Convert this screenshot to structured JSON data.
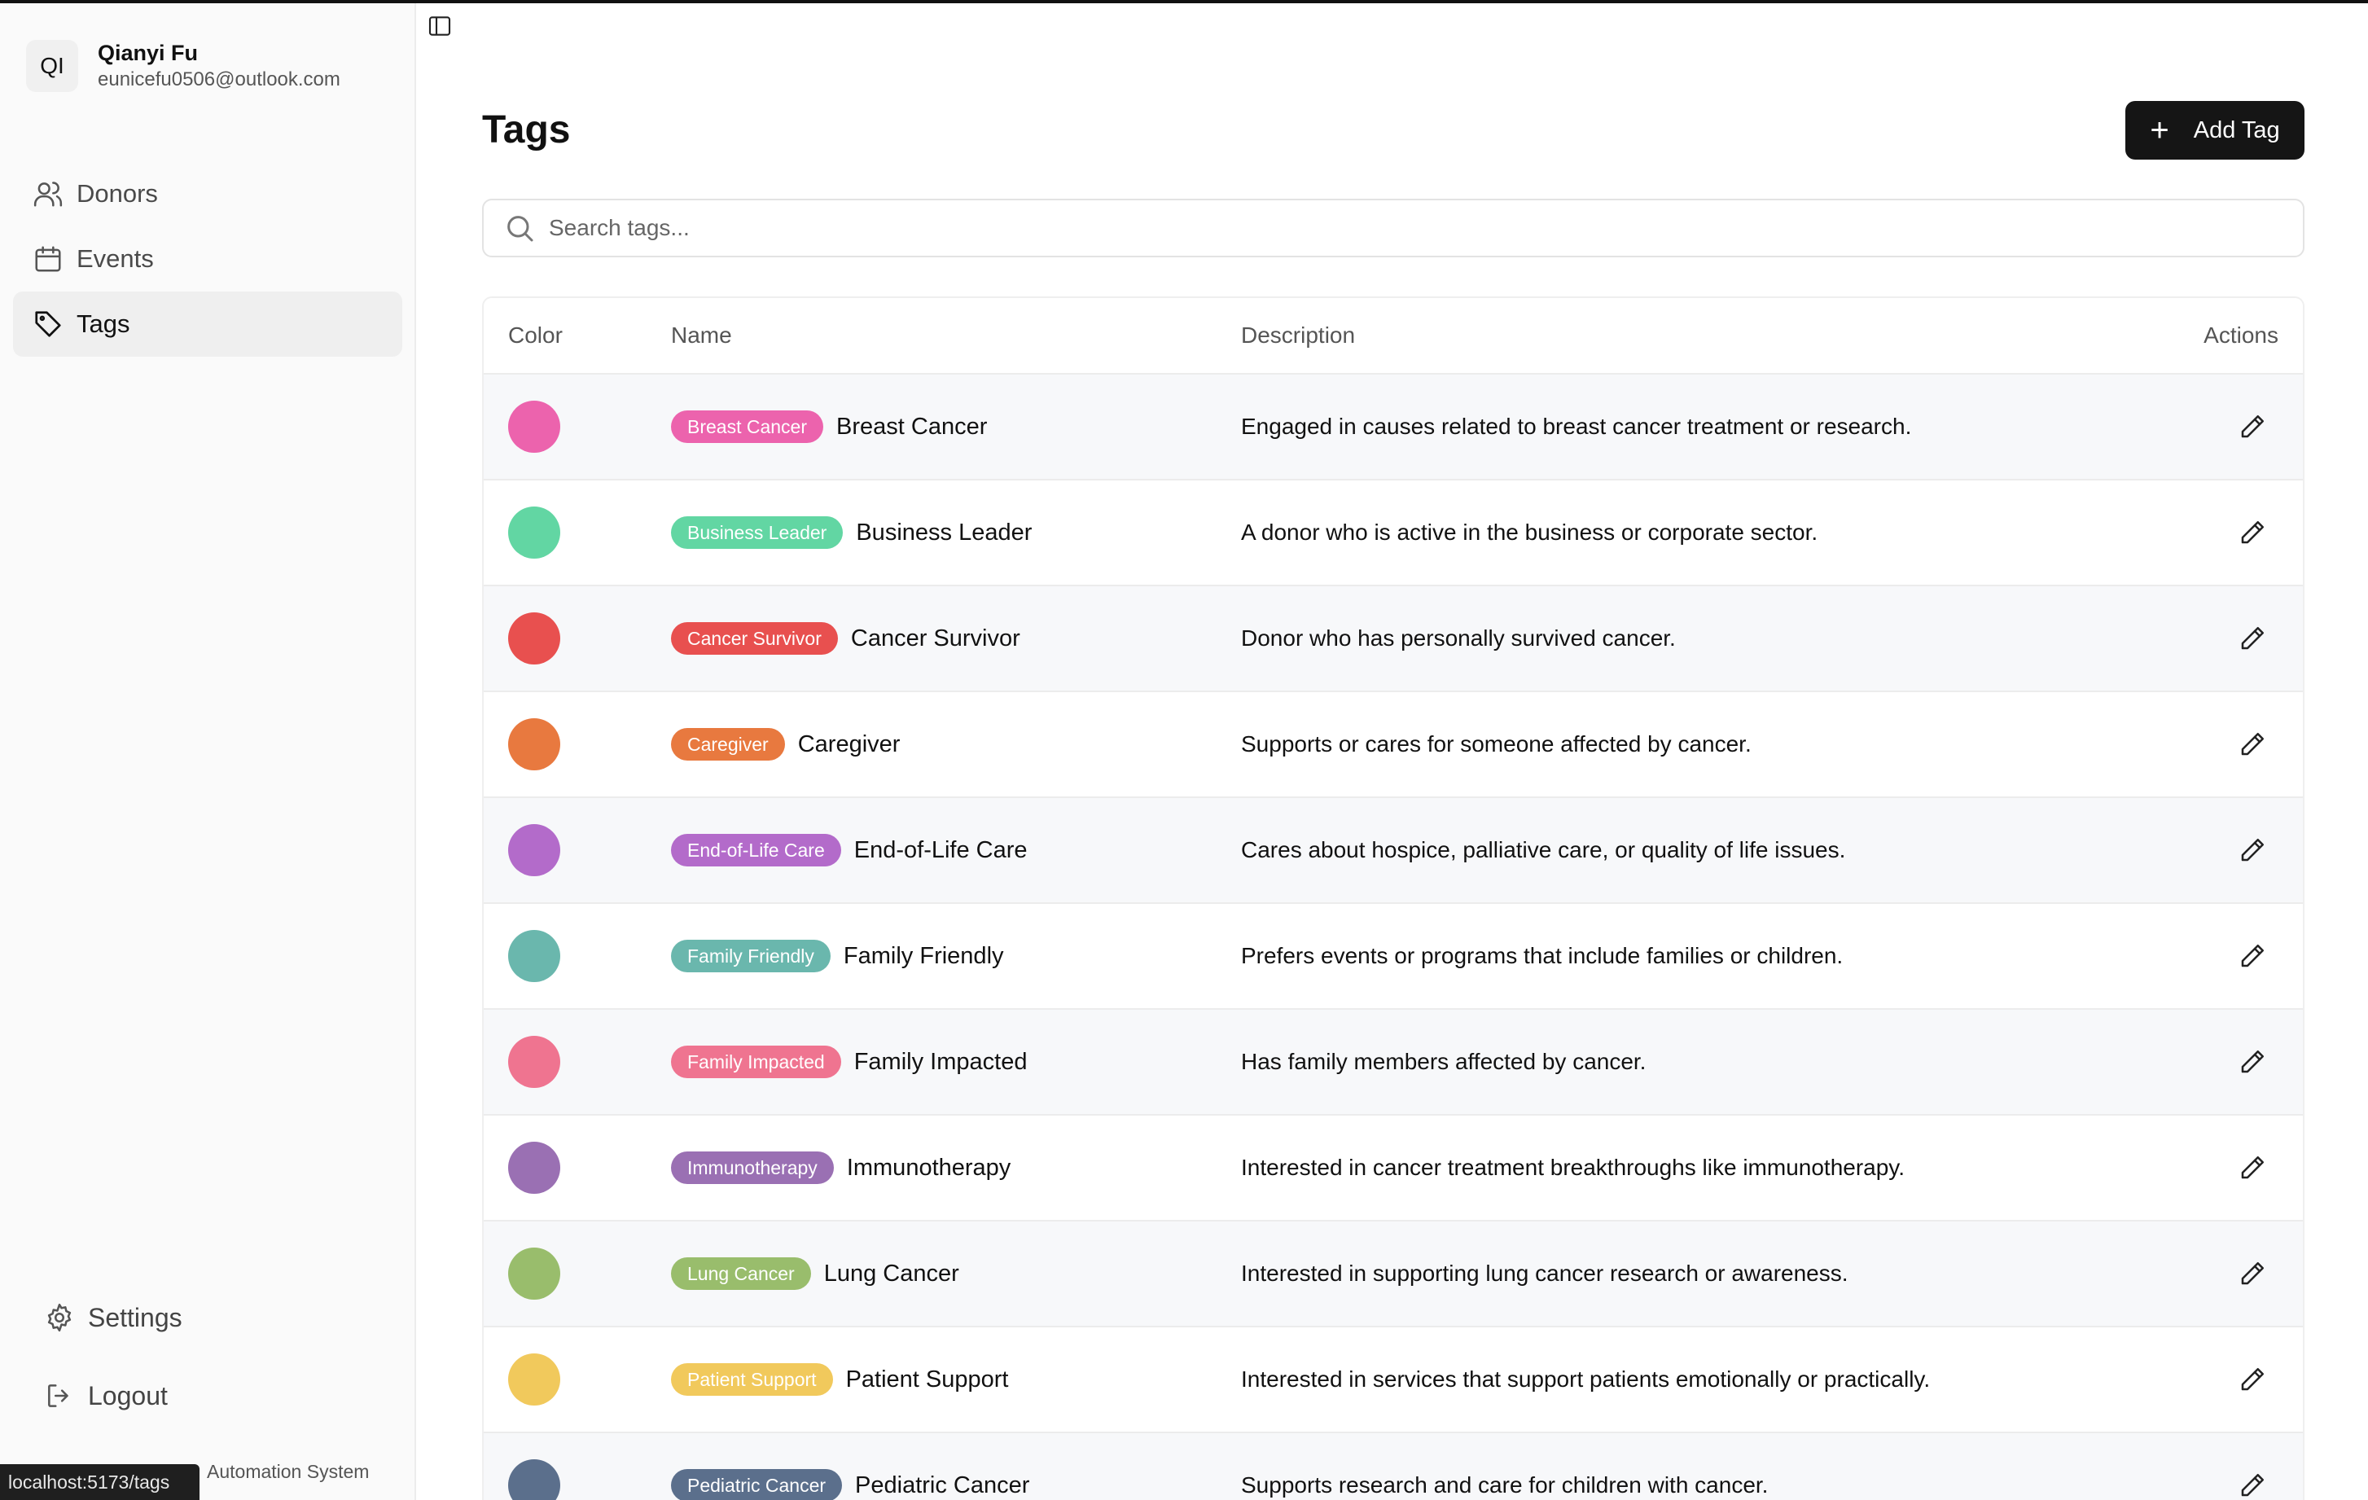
{
  "user": {
    "initials": "QI",
    "name": "Qianyi Fu",
    "email": "eunicefu0506@outlook.com"
  },
  "nav": [
    {
      "label": "Donors",
      "icon": "users-icon"
    },
    {
      "label": "Events",
      "icon": "calendar-icon"
    },
    {
      "label": "Tags",
      "icon": "tag-icon",
      "active": true
    }
  ],
  "bottom_nav": {
    "settings": "Settings",
    "logout": "Logout"
  },
  "footer": {
    "text": "Automation System",
    "status_url": "localhost:5173/tags"
  },
  "page": {
    "title": "Tags",
    "add_button": "Add Tag",
    "search_placeholder": "Search tags..."
  },
  "table": {
    "headers": {
      "color": "Color",
      "name": "Name",
      "description": "Description",
      "actions": "Actions"
    },
    "rows": [
      {
        "badge": "Breast Cancer",
        "name": "Breast Cancer",
        "color": "#ec63ad",
        "description": "Engaged in causes related to breast cancer treatment or research."
      },
      {
        "badge": "Business Leader",
        "name": "Business Leader",
        "color": "#62d6a3",
        "description": "A donor who is active in the business or corporate sector."
      },
      {
        "badge": "Cancer Survivor",
        "name": "Cancer Survivor",
        "color": "#e8504f",
        "description": "Donor who has personally survived cancer."
      },
      {
        "badge": "Caregiver",
        "name": "Caregiver",
        "color": "#e8793f",
        "description": "Supports or cares for someone affected by cancer."
      },
      {
        "badge": "End-of-Life Care",
        "name": "End-of-Life Care",
        "color": "#b36bca",
        "description": "Cares about hospice, palliative care, or quality of life issues."
      },
      {
        "badge": "Family Friendly",
        "name": "Family Friendly",
        "color": "#6ab7ad",
        "description": "Prefers events or programs that include families or children."
      },
      {
        "badge": "Family Impacted",
        "name": "Family Impacted",
        "color": "#ef7490",
        "description": "Has family members affected by cancer."
      },
      {
        "badge": "Immunotherapy",
        "name": "Immunotherapy",
        "color": "#9a70b3",
        "description": "Interested in cancer treatment breakthroughs like immunotherapy."
      },
      {
        "badge": "Lung Cancer",
        "name": "Lung Cancer",
        "color": "#99bd6c",
        "description": "Interested in supporting lung cancer research or awareness."
      },
      {
        "badge": "Patient Support",
        "name": "Patient Support",
        "color": "#f1c95c",
        "description": "Interested in services that support patients emotionally or practically."
      },
      {
        "badge": "Pediatric Cancer",
        "name": "Pediatric Cancer",
        "color": "#5b6f8c",
        "description": "Supports research and care for children with cancer."
      }
    ]
  }
}
